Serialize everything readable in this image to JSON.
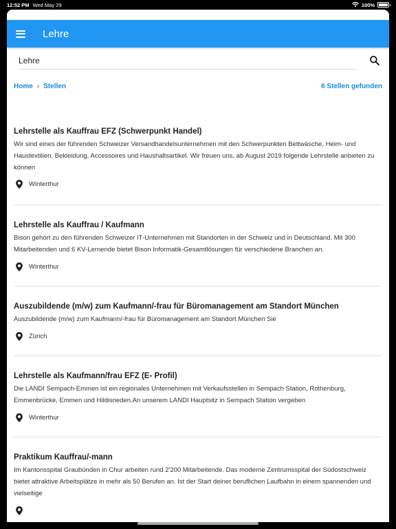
{
  "status_bar": {
    "time": "12:52 PM",
    "date": "Wed May 29",
    "battery": "100%"
  },
  "app_bar": {
    "title": "Lehre"
  },
  "search": {
    "value": "Lehre"
  },
  "breadcrumb": {
    "home": "Home",
    "current": "Stellen"
  },
  "result_count": "6 Stellen gefunden",
  "jobs": [
    {
      "title": "Lehrstelle als Kauffrau EFZ (Schwerpunkt Handel)",
      "description": "Wir sind eines der führenden Schweizer Versandhandelsunternehmen mit den Schwerpunkten Bettwäsche, Heim- und Haustextilien, Bekleidung, Accessoires und Haushaltsartikel. Wir freuen uns, ab August 2019 folgende Lehrstelle anbieten zu können",
      "location": "Winterthur"
    },
    {
      "title": "Lehrstelle als Kauffrau / Kaufmann",
      "description": "Bison gehört zu den führenden Schweizer IT-Unternehmen mit Standorten in der Schweiz und in Deutschland. Mit 300 Mitarbeitenden und 6 KV-Lernende bietet Bison Informatik-Gesamtlösungen für verschiedene Branchen an.",
      "location": "Winterthur"
    },
    {
      "title": "Auszubildende (m/w) zum Kaufmann/-frau für Büromanagement am Standort München",
      "description": "Auszubildende (m/w) zum Kaufmann/-frau für Büromanagement am Standort München Sie",
      "location": "Zürich"
    },
    {
      "title": "Lehrstelle als Kaufmann/frau EFZ (E- Profil)",
      "description": "Die LANDI Sempach-Emmen ist ein regionales Unternehmen mit Verkaufsstellen in Sempach Station, Rothenburg, Emmenbrücke, Emmen und Hildisrieden.An unserem LANDI Hauptsitz in Sempach Station vergeben",
      "location": "Winterthur"
    },
    {
      "title": "Praktikum Kauffrau/-mann",
      "description": "Im Kantonsspital Graubünden in Chur arbeiten rund 2'200 Mitarbeitende. Das moderne Zentrumsspital der Südostschweiz bietet attraktive Arbeitsplätze in mehr als 50 Berufen an. Ist der Start deiner beruflichen Laufbahn in einem spannenden und vielseitige",
      "location": ""
    }
  ],
  "colors": {
    "primary": "#2196f3",
    "link": "#1a8be0"
  }
}
